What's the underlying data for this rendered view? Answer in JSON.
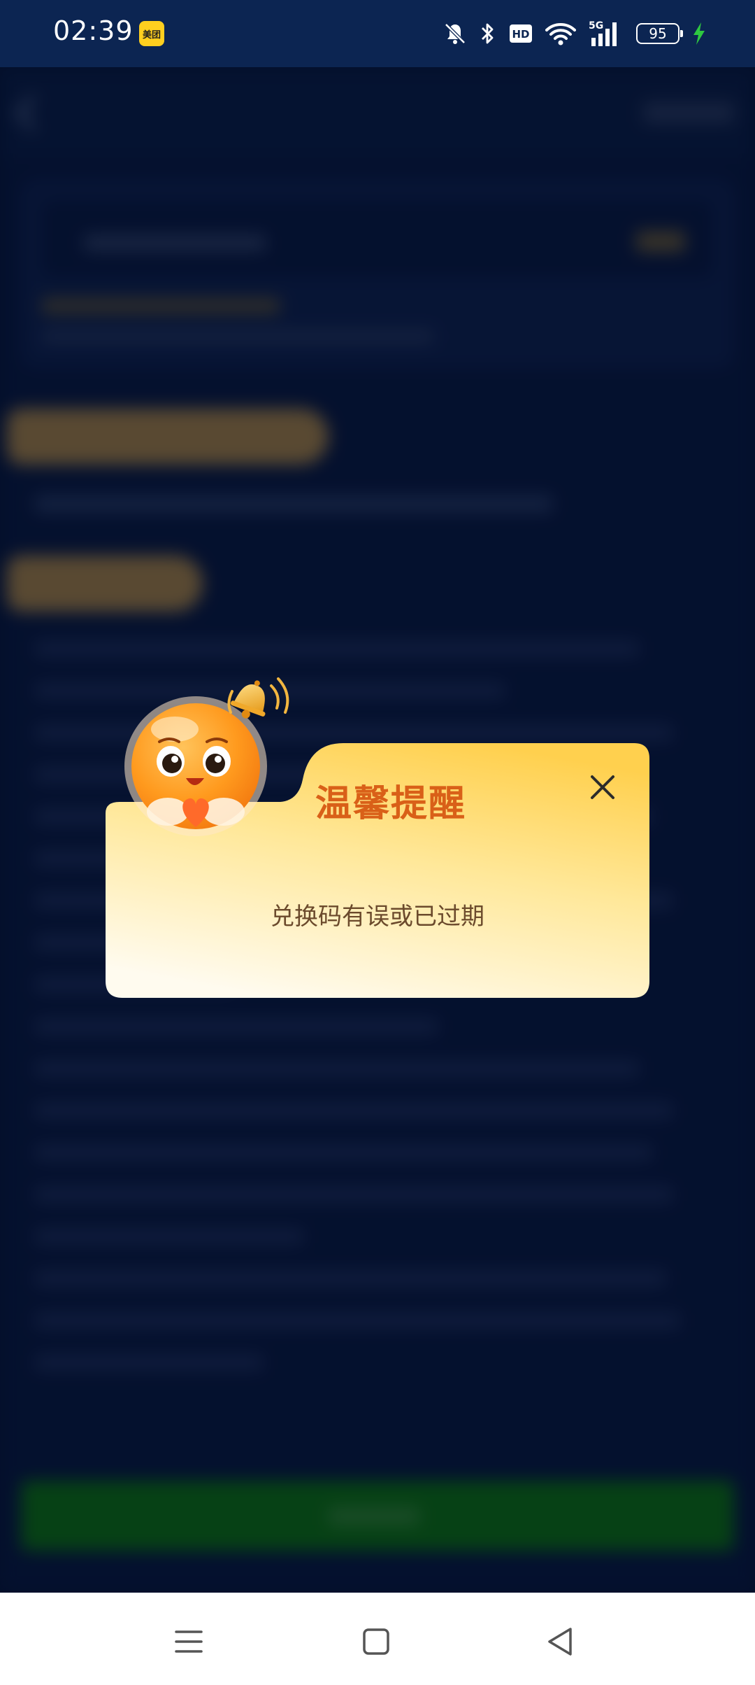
{
  "status_bar": {
    "time": "02:39",
    "app_badge": "美团",
    "battery_level": "95",
    "icons": [
      "mute-icon",
      "bluetooth-icon",
      "hd-icon",
      "wifi-icon",
      "signal-5g-icon",
      "battery-icon",
      "charging-icon"
    ],
    "network_label": "5G",
    "hd_label": "HD"
  },
  "dialog": {
    "title": "温馨提醒",
    "message": "兑换码有误或已过期",
    "colors": {
      "title": "#d96018",
      "message": "#6b4a2c",
      "gradient_top": "#ffd35a",
      "gradient_bottom": "#fffbf0"
    }
  },
  "nav_bar": {
    "buttons": [
      "menu-icon",
      "home-icon",
      "back-icon"
    ]
  },
  "colors": {
    "background": "#071a3f",
    "status_bar": "#0c2552",
    "charging_green": "#2ec840"
  }
}
